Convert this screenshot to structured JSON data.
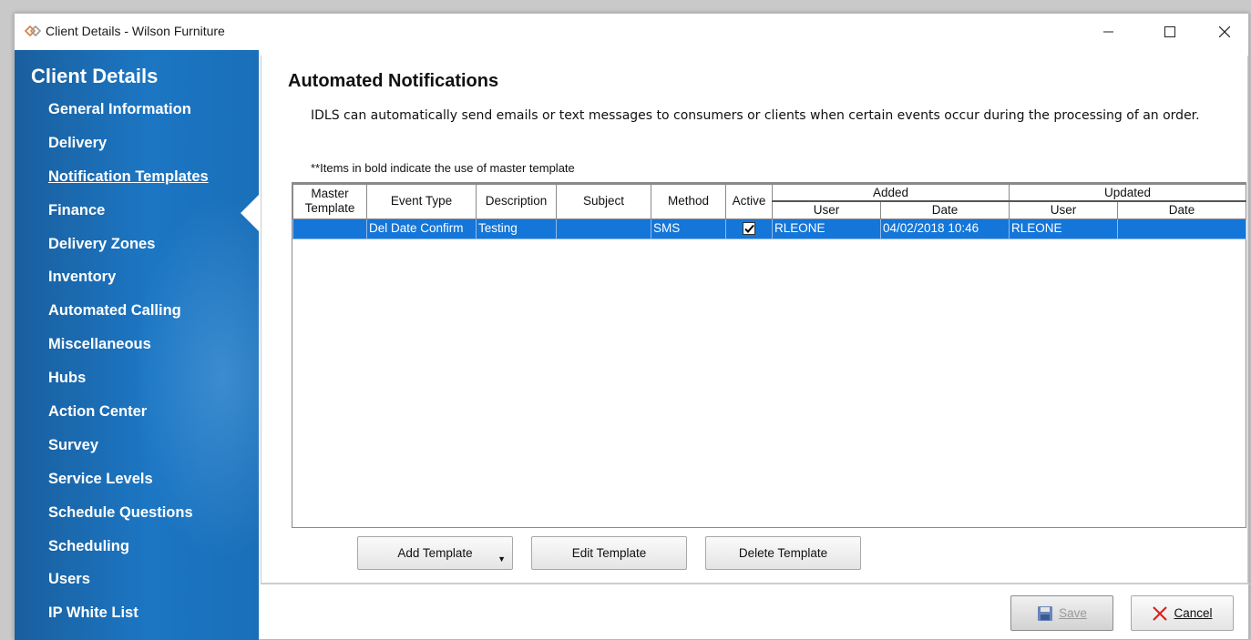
{
  "window": {
    "title": "Client Details - Wilson Furniture",
    "accent": "#1c76c3"
  },
  "sidebar": {
    "title": "Client Details",
    "items": [
      {
        "label": "General Information"
      },
      {
        "label": "Delivery"
      },
      {
        "label": "Notification Templates",
        "active": true
      },
      {
        "label": "Finance"
      },
      {
        "label": "Delivery Zones"
      },
      {
        "label": "Inventory"
      },
      {
        "label": "Automated Calling"
      },
      {
        "label": "Miscellaneous"
      },
      {
        "label": "Hubs"
      },
      {
        "label": "Action Center"
      },
      {
        "label": "Survey"
      },
      {
        "label": "Service Levels"
      },
      {
        "label": "Schedule Questions"
      },
      {
        "label": "Scheduling"
      },
      {
        "label": "Users"
      },
      {
        "label": "IP White List"
      }
    ]
  },
  "main": {
    "title": "Automated Notifications",
    "description": "IDLS can automatically send emails or text messages to consumers or clients when certain events occur during the processing of an order.",
    "note": "**Items in bold indicate the use of master template",
    "grid": {
      "headers": {
        "master_template_line1": "Master",
        "master_template_line2": "Template",
        "event_type": "Event Type",
        "description": "Description",
        "subject": "Subject",
        "method": "Method",
        "active": "Active",
        "added": "Added",
        "updated": "Updated",
        "user": "User",
        "date": "Date"
      },
      "rows": [
        {
          "master_template": "",
          "event_type": "Del Date Confirm",
          "description": "Testing",
          "subject": "",
          "method": "SMS",
          "active": true,
          "added_user": "RLEONE",
          "added_date": "04/02/2018 10:46",
          "updated_user": "RLEONE",
          "updated_date": ""
        }
      ],
      "selected_row_color": "#1476d9"
    },
    "buttons": {
      "add_template": "Add Template",
      "edit_template": "Edit Template",
      "delete_template": "Delete Template"
    }
  },
  "footer": {
    "save_label": "Save",
    "cancel_label": "Cancel"
  }
}
